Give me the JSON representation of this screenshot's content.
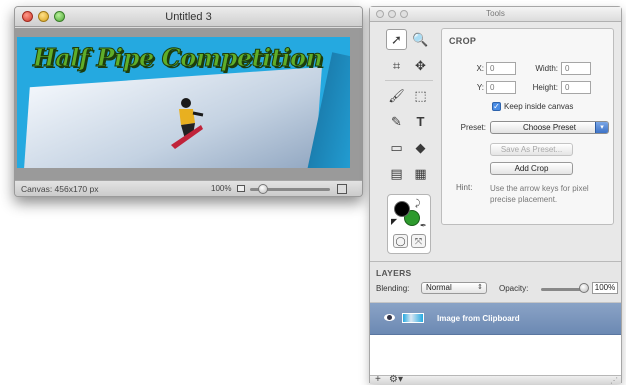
{
  "document_window": {
    "title": "Untitled 3",
    "image": {
      "headline": "Half Pipe Competition",
      "sky_color": "#25a9e0",
      "text_color": "#5fae2a"
    },
    "status": {
      "canvas_size": "Canvas: 456x170 px",
      "zoom": "100%"
    }
  },
  "tools_panel": {
    "title": "Tools",
    "tools": [
      {
        "name": "move-tool",
        "icon": "➚"
      },
      {
        "name": "zoom-tool",
        "icon": "🔍"
      },
      {
        "name": "crop-tool",
        "icon": "⌗"
      },
      {
        "name": "hand-tool",
        "icon": "✥"
      },
      {
        "name": "brush-tool",
        "icon": "🖌"
      },
      {
        "name": "selection-tool",
        "icon": "⬚"
      },
      {
        "name": "eraser-tool",
        "icon": "✎"
      },
      {
        "name": "text-tool",
        "icon": "T"
      },
      {
        "name": "rectangle-tool",
        "icon": "▭"
      },
      {
        "name": "paint-bucket-tool",
        "icon": "◆"
      },
      {
        "name": "shape-tool",
        "icon": "▤"
      },
      {
        "name": "gradient-tool",
        "icon": "▦"
      }
    ],
    "colors": {
      "foreground": "#000000",
      "background": "#2d9a2d"
    },
    "crop": {
      "heading": "CROP",
      "x_label": "X:",
      "x_value": "0",
      "y_label": "Y:",
      "y_value": "0",
      "width_label": "Width:",
      "width_value": "0",
      "height_label": "Height:",
      "height_value": "0",
      "keep_inside_label": "Keep inside canvas",
      "keep_inside_checked": true,
      "preset_label": "Preset:",
      "preset_value": "Choose Preset",
      "save_preset_label": "Save As Preset...",
      "add_crop_label": "Add Crop",
      "hint_label": "Hint:",
      "hint_text": "Use the arrow keys for pixel precise placement."
    },
    "layers": {
      "heading": "LAYERS",
      "blending_label": "Blending:",
      "blending_value": "Normal",
      "opacity_label": "Opacity:",
      "opacity_value": "100%",
      "opacity_fraction": 1.0,
      "items": [
        {
          "name": "Image from Clipboard",
          "visible": true,
          "selected": true
        }
      ]
    }
  }
}
